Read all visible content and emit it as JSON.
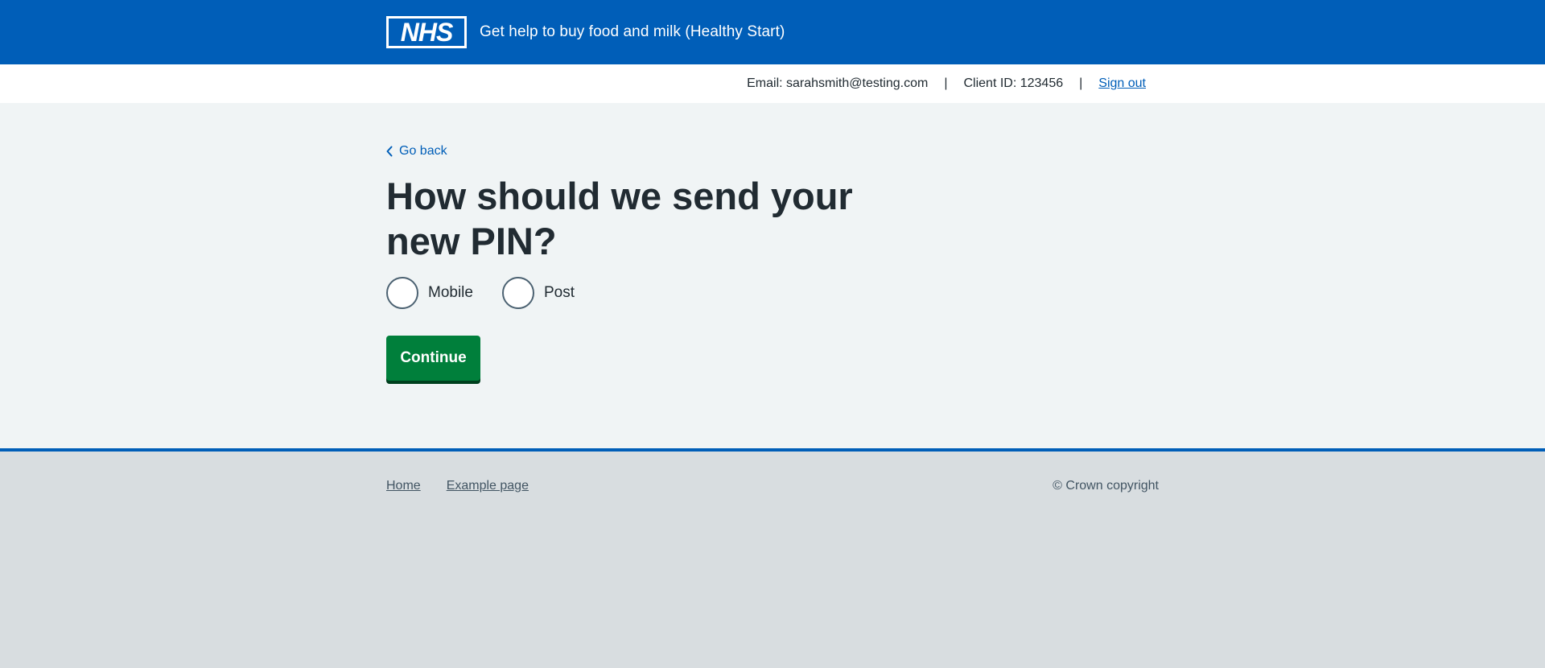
{
  "header": {
    "logo_text": "NHS",
    "service_name": "Get help to buy food and milk (Healthy Start)"
  },
  "account": {
    "email": "Email: sarahsmith@testing.com",
    "separator": "|",
    "client_id": "Client ID: 123456",
    "sign_out": "Sign out"
  },
  "main": {
    "back_link": "Go back",
    "title": "How should we send your new PIN?",
    "radios": [
      {
        "label": "Mobile",
        "checked": false
      },
      {
        "label": "Post",
        "checked": false
      }
    ],
    "continue_label": "Continue"
  },
  "footer": {
    "links": [
      "Home",
      "Example page"
    ],
    "copyright": "© Crown copyright"
  },
  "colors": {
    "nhs_blue": "#005eb8",
    "button_green": "#007f3b",
    "page_background": "#f0f4f5",
    "footer_background": "#d8dde0"
  }
}
